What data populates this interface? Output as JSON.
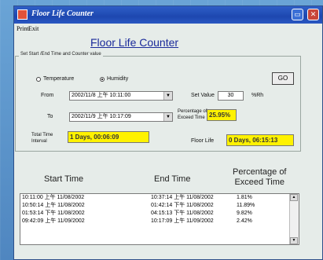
{
  "window": {
    "title": "Floor Life Counter"
  },
  "menu": [
    "Print",
    "Exit"
  ],
  "main_title": "Floor Life Counter",
  "group_label": "Set Start /End Time and Counter value",
  "go_button": "GO",
  "mode": {
    "temperature": "Temperature",
    "humidity": "Humidity",
    "selected": "humidity"
  },
  "from": {
    "label": "From",
    "value": "2002/11/8 上午 10:11:00"
  },
  "to": {
    "label": "To",
    "value": "2002/11/9 上午 10:17:09"
  },
  "set_value": {
    "label": "Set Value",
    "value": "30",
    "unit": "%Rh"
  },
  "exceed": {
    "label_line1": "Percentage of",
    "label_line2": "Exceed Time",
    "value": "25.95%"
  },
  "total_time": {
    "label_line1": "Total Time",
    "label_line2": "Interval",
    "value": "1 Days, 00:06:09"
  },
  "floor_life": {
    "label": "Floor Life",
    "value": "0 Days, 06:15:13"
  },
  "table": {
    "headers": {
      "start": "Start Time",
      "end": "End Time",
      "pct1": "Percentage of",
      "pct2": "Exceed Time"
    },
    "rows": [
      {
        "start": "10:11:00 上午 11/08/2002",
        "end": "10:37:14 上午 11/08/2002",
        "pct": "1.81%"
      },
      {
        "start": "10:50:14 上午 11/08/2002",
        "end": "01:42:14 下午 11/08/2002",
        "pct": "11.89%"
      },
      {
        "start": "01:53:14 下午 11/08/2002",
        "end": "04:15:13 下午 11/08/2002",
        "pct": "9.82%"
      },
      {
        "start": "09:42:09 上午 11/09/2002",
        "end": "10:17:09 上午 11/09/2002",
        "pct": "2.42%"
      }
    ]
  }
}
